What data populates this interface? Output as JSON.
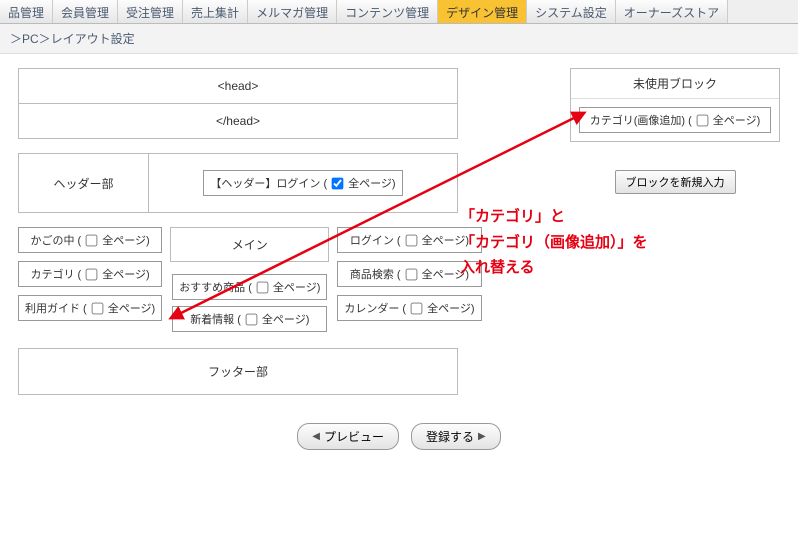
{
  "tabs": {
    "t0": "品管理",
    "t1": "会員管理",
    "t2": "受注管理",
    "t3": "売上集計",
    "t4": "メルマガ管理",
    "t5": "コンテンツ管理",
    "t6": "デザイン管理",
    "t7": "システム設定",
    "t8": "オーナーズストア"
  },
  "breadcrumb": "＞PC＞レイアウト設定",
  "head": {
    "open": "<head>",
    "close": "</head>"
  },
  "header_section": {
    "label": "ヘッダー部",
    "block": {
      "pre": "【ヘッダー】ログイン (",
      "post": " 全ページ)"
    }
  },
  "main_label": "メイン",
  "left_col": {
    "b0": {
      "pre": "かごの中 (",
      "post": " 全ページ)"
    },
    "b1": {
      "pre": "カテゴリ (",
      "post": " 全ページ)"
    },
    "b2": {
      "pre": "利用ガイド (",
      "post": " 全ページ)"
    }
  },
  "mid_col": {
    "b0": {
      "pre": "おすすめ商品 (",
      "post": " 全ページ)"
    },
    "b1": {
      "pre": "新着情報 (",
      "post": " 全ページ)"
    }
  },
  "right_col": {
    "b0": {
      "pre": "ログイン (",
      "post": " 全ページ)"
    },
    "b1": {
      "pre": "商品検索 (",
      "post": " 全ページ)"
    },
    "b2": {
      "pre": "カレンダー (",
      "post": " 全ページ)"
    }
  },
  "footer_label": "フッター部",
  "unused": {
    "title": "未使用ブロック",
    "block": {
      "pre": "カテゴリ(画像追加) (",
      "post": " 全ページ)"
    },
    "new_button": "ブロックを新規入力"
  },
  "buttons": {
    "preview": "プレビュー",
    "register": "登録する"
  },
  "annotation": "「カテゴリ」と\n「カテゴリ（画像追加）」を\n入れ替える"
}
